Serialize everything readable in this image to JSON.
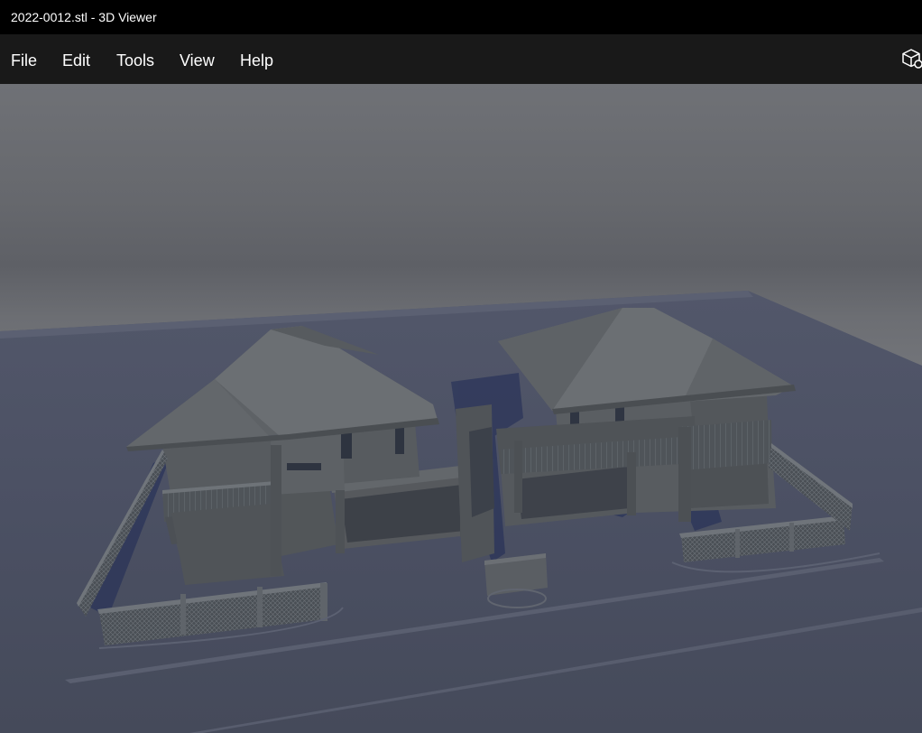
{
  "window": {
    "title": "2022-0012.stl - 3D Viewer"
  },
  "menubar": {
    "items": [
      {
        "id": "file",
        "label": "File"
      },
      {
        "id": "edit",
        "label": "Edit"
      },
      {
        "id": "tools",
        "label": "Tools"
      },
      {
        "id": "view",
        "label": "View"
      },
      {
        "id": "help",
        "label": "Help"
      }
    ],
    "mode_icon": "cube-icon"
  },
  "viewport": {
    "model": "two-storey duplex house model on ground plate",
    "colors": {
      "background_top": "#6f7176",
      "ground": "#484d5c",
      "model": "#4f5358",
      "shadow": "#1d2750"
    }
  }
}
